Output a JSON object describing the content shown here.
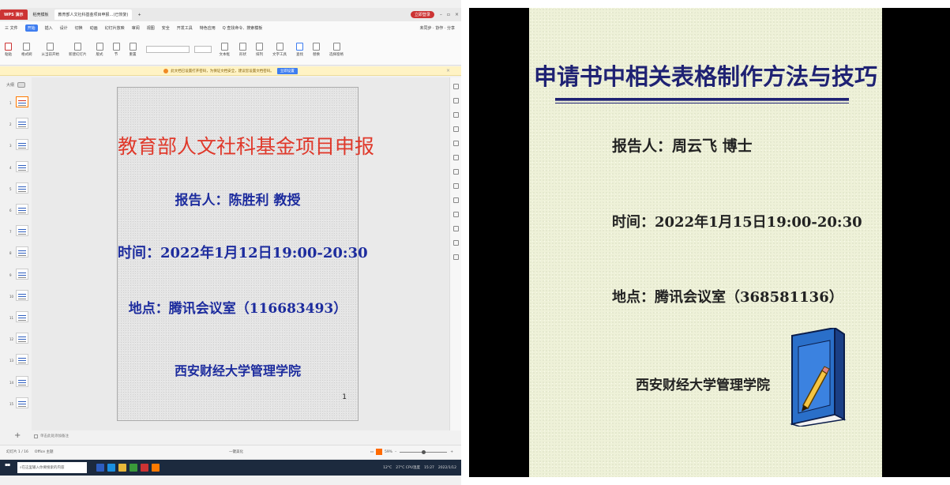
{
  "wps": {
    "tabs": [
      "WPS 演示",
      "稻壳模板",
      "教育部人文社科基金项目申报…(已恢复)"
    ],
    "login_label": "立即登录",
    "menus": [
      "三 文件",
      "开始",
      "插入",
      "设计",
      "切换",
      "动画",
      "幻灯片放映",
      "审阅",
      "视图",
      "安全",
      "开发工具",
      "特色应用"
    ],
    "active_menu": "开始",
    "search_label": "Q 查找命令、搜索模板",
    "menu_right": "未同步 · 协作 · 分享",
    "toolbar": [
      "粘贴",
      "格式刷",
      "从当前开始",
      "新建幻灯片",
      "版式",
      "节",
      "重置",
      "文本框",
      "形状",
      "排列",
      "文字工具",
      "查找",
      "替换",
      "选择窗格"
    ],
    "notice_text": "此文档已设置打开密码，为保证文档安全，建议您设置文档密码。",
    "notice_btn": "立即设置",
    "panel_label": "大纲",
    "thumb_count": 15,
    "active_thumb": 1,
    "notes_placeholder": "单击此处添加备注",
    "status_left": "幻灯片 1 / 16",
    "status_theme": "Office 主题",
    "status_center": "一键美化",
    "status_zoom": "59%",
    "taskbar_search": "在这里输入你要搜索的内容",
    "tray_weather": "12°C",
    "tray_cpu": "27°C CPU温度",
    "tray_time": "15:27",
    "tray_date": "2022/1/12"
  },
  "slide1": {
    "title": "教育部人文社科基金项目申报",
    "reporter": "报告人：陈胜利 教授",
    "time": "时间：2022年1月12日19:00-20:30",
    "place": "地点：腾讯会议室（116683493）",
    "institution": "西安财经大学管理学院",
    "page_num": "1",
    "title_color": "#e0392b",
    "body_color": "#1d2c9e"
  },
  "slide2": {
    "title": "申请书中相关表格制作方法与技巧",
    "reporter": "报告人：周云飞 博士",
    "time": "时间：2022年1月15日19:00-20:30",
    "place": "地点：腾讯会议室（368581136）",
    "institution": "西安财经大学管理学院",
    "title_color": "#1f2273",
    "book_icon": "book-with-pencil-icon"
  }
}
